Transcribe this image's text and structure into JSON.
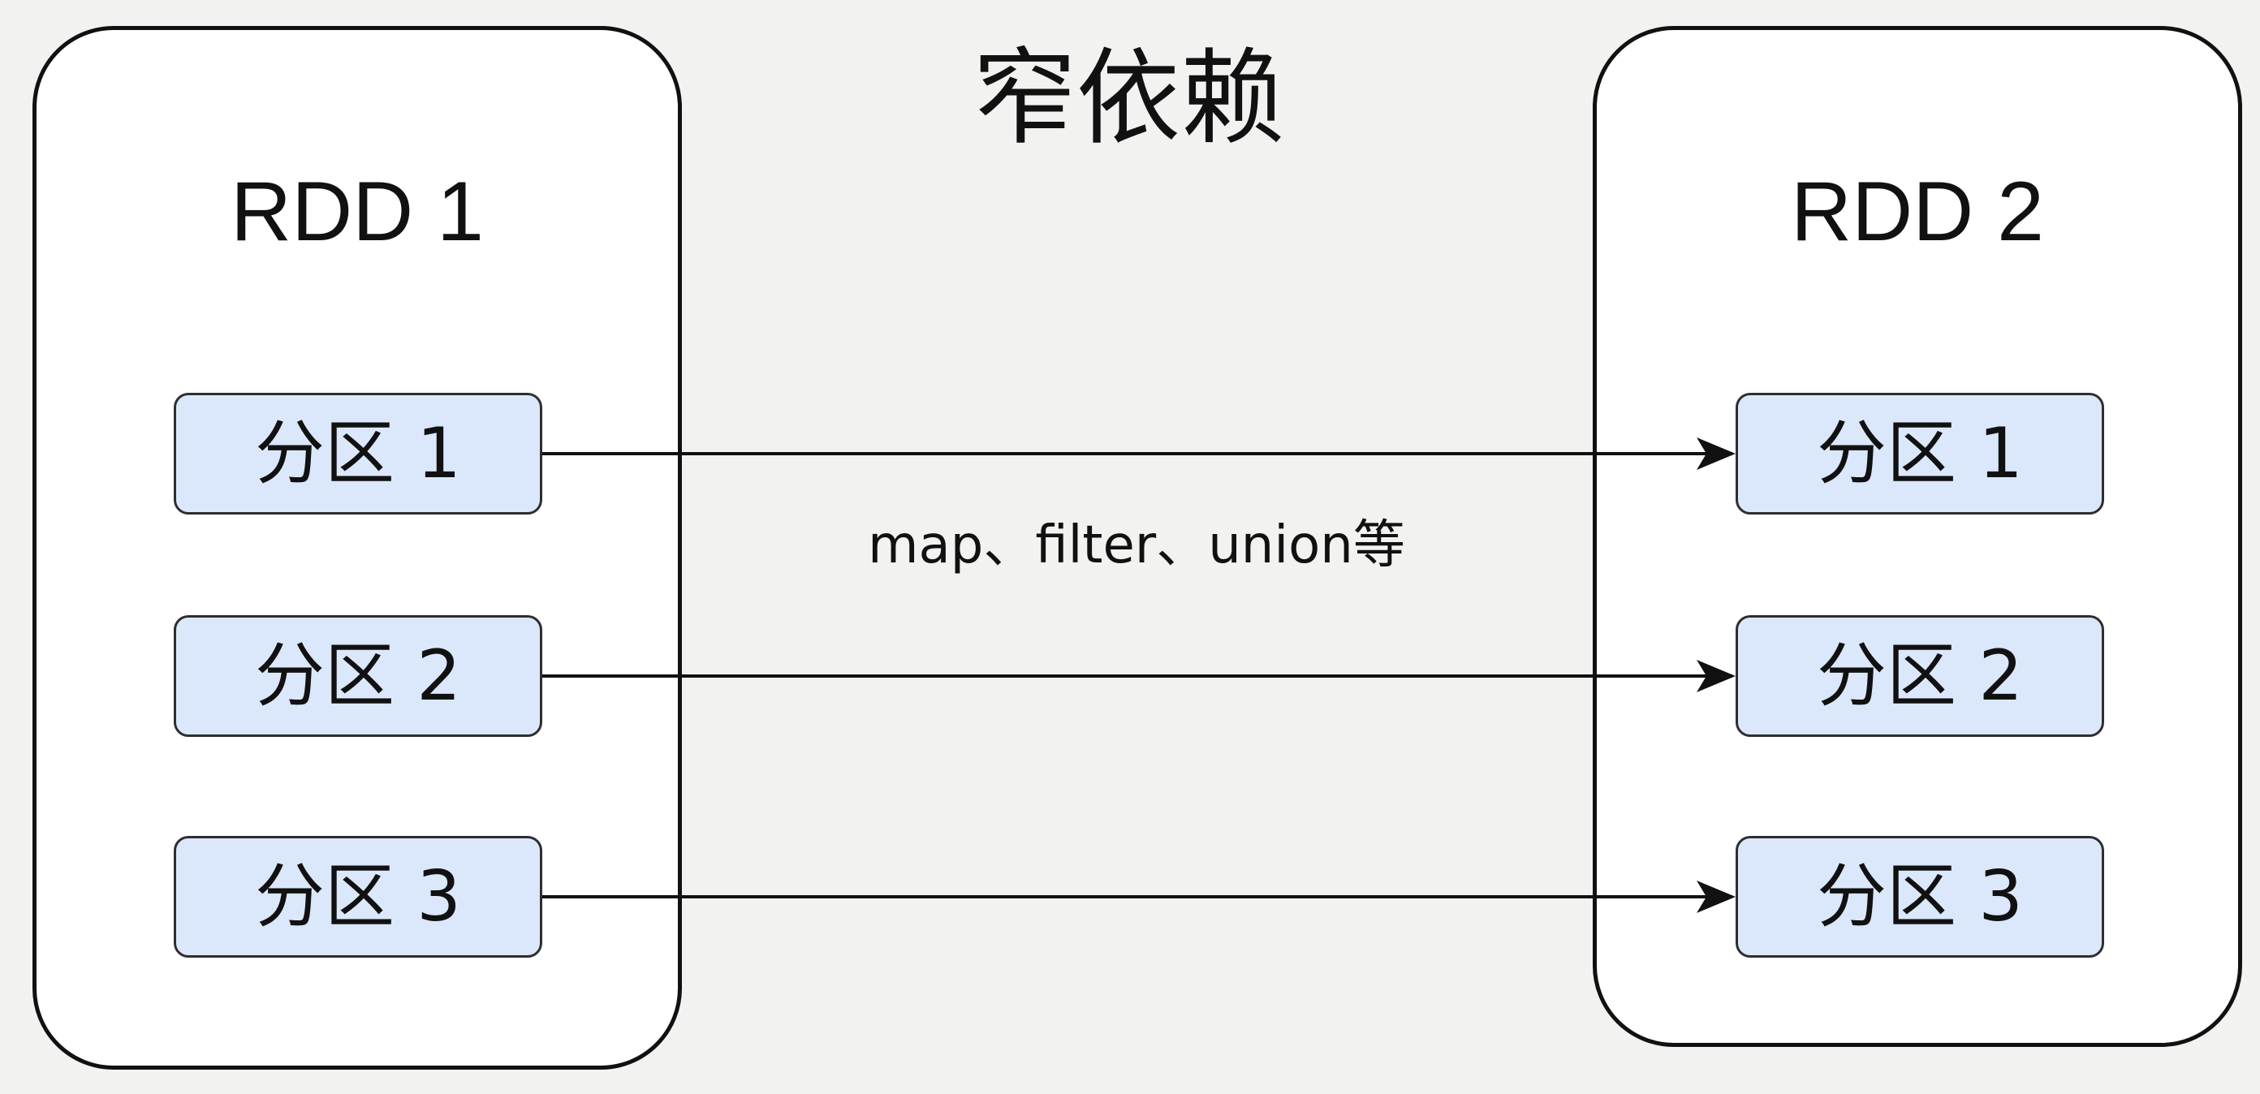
{
  "title": "窄依赖",
  "operation_label": "map、filter、union等",
  "rdd_left": {
    "title": "RDD 1",
    "partitions": [
      "分区 1",
      "分区 2",
      "分区 3"
    ]
  },
  "rdd_right": {
    "title": "RDD 2",
    "partitions": [
      "分区 1",
      "分区 2",
      "分区 3"
    ]
  },
  "colors": {
    "background": "#f2f2f0",
    "partition_fill": "#dbe8fb",
    "stroke": "#111111"
  }
}
